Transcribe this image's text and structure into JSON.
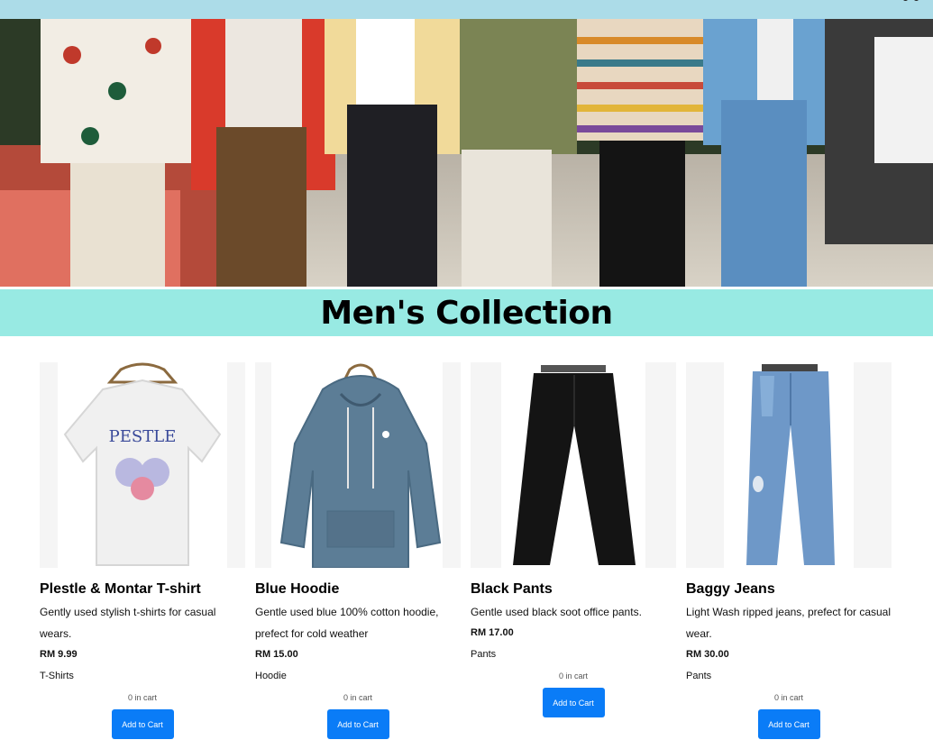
{
  "header": {
    "cart_icon": "shopping-cart-icon"
  },
  "hero": {
    "image": "group-of-men-walking-in-garden-photo"
  },
  "banner": {
    "title": "Men's Collection"
  },
  "products": [
    {
      "name": "Plestle & Montar T-shirt",
      "description": "Gently used stylish t-shirts for casual wears.",
      "price": "RM 9.99",
      "category": "T-Shirts",
      "in_cart": "0 in cart",
      "button": "Add to Cart",
      "image": "white-graphic-tshirt-photo"
    },
    {
      "name": "Blue Hoodie",
      "description": "Gentle used blue 100% cotton hoodie, prefect for cold weather",
      "price": "RM 15.00",
      "category": "Hoodie",
      "in_cart": "0 in cart",
      "button": "Add to Cart",
      "image": "blue-hoodie-photo"
    },
    {
      "name": "Black Pants",
      "description": "Gentle used black soot office pants.",
      "price": "RM 17.00",
      "category": "Pants",
      "in_cart": "0 in cart",
      "button": "Add to Cart",
      "image": "black-pants-photo"
    },
    {
      "name": "Baggy Jeans",
      "description": "Light Wash ripped jeans, prefect for casual wear.",
      "price": "RM 30.00",
      "category": "Pants",
      "in_cart": "0 in cart",
      "button": "Add to Cart",
      "image": "ripped-jeans-photo"
    }
  ],
  "colors": {
    "topbar": "#acdce8",
    "banner": "#98eae3",
    "button": "#0a7cf7"
  }
}
